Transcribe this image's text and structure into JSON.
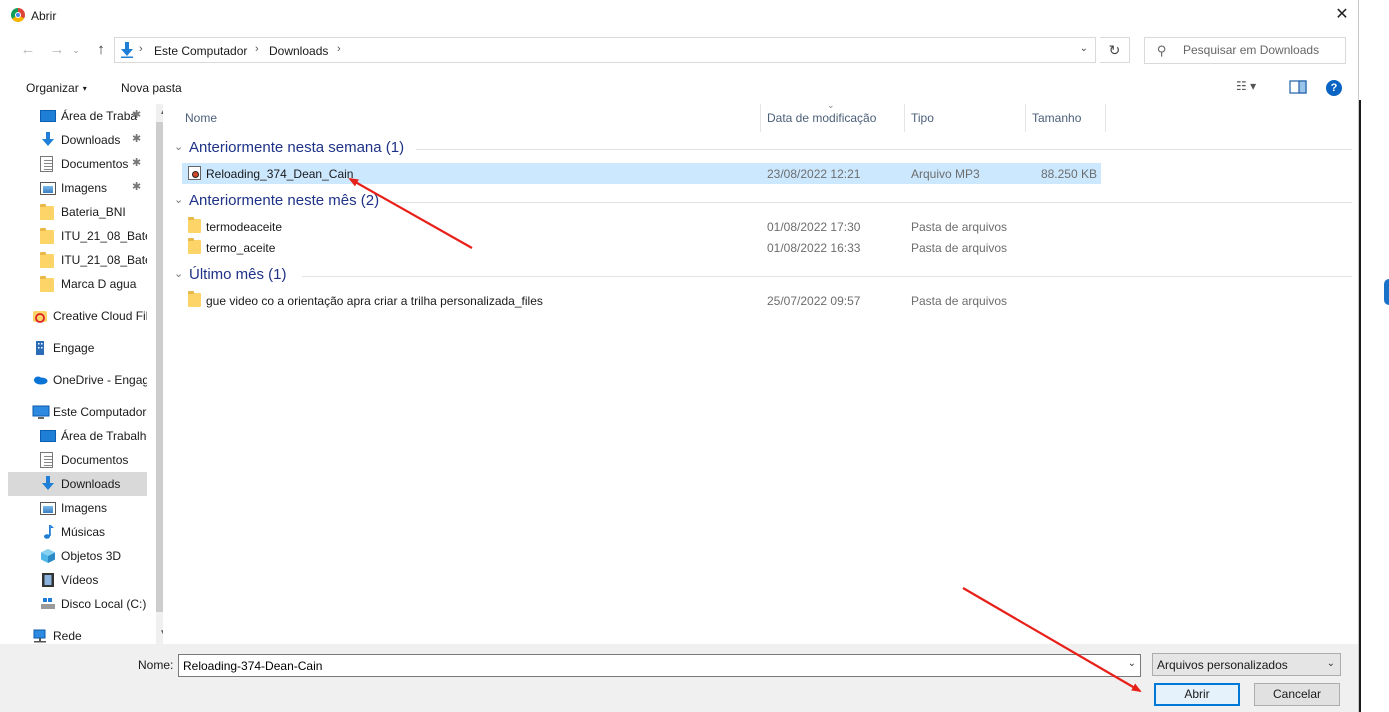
{
  "window": {
    "title": "Abrir",
    "close_glyph": "✕"
  },
  "nav": {
    "back_glyph": "←",
    "forward_glyph": "→",
    "recent_glyph": "⌄",
    "up_glyph": "↑",
    "breadcrumb": [
      "Este Computador",
      "Downloads"
    ],
    "breadcrumb_sep": "›",
    "refresh_glyph": "↻",
    "search_placeholder": "Pesquisar em Downloads"
  },
  "toolbar": {
    "organize_label": "Organizar",
    "organize_caret": "▾",
    "new_folder_label": "Nova pasta",
    "view_glyph": "☷ ▾",
    "help_glyph": "?"
  },
  "sidebar": {
    "pin_glyph": "✱",
    "items": [
      {
        "label": "Área de Traba",
        "icon": "desktop-icon",
        "pinned": true
      },
      {
        "label": "Downloads",
        "icon": "download-icon",
        "pinned": true
      },
      {
        "label": "Documentos",
        "icon": "document-icon",
        "pinned": true
      },
      {
        "label": "Imagens",
        "icon": "pictures-icon",
        "pinned": true
      },
      {
        "label": "Bateria_BNI",
        "icon": "folder-icon"
      },
      {
        "label": "ITU_21_08_Bateri",
        "icon": "folder-icon"
      },
      {
        "label": "ITU_21_08_Bateri",
        "icon": "folder-icon"
      },
      {
        "label": "Marca D agua",
        "icon": "folder-icon"
      },
      {
        "label": "Creative Cloud Fil",
        "icon": "creative-cloud-icon"
      },
      {
        "label": "Engage",
        "icon": "building-icon"
      },
      {
        "label": "OneDrive - Engag",
        "icon": "onedrive-icon"
      },
      {
        "label": "Este Computador",
        "icon": "computer-icon"
      },
      {
        "label": "Área de Trabalho",
        "icon": "desktop-icon"
      },
      {
        "label": "Documentos",
        "icon": "document-icon"
      },
      {
        "label": "Downloads",
        "icon": "download-icon",
        "selected": true
      },
      {
        "label": "Imagens",
        "icon": "pictures-icon"
      },
      {
        "label": "Músicas",
        "icon": "music-icon"
      },
      {
        "label": "Objetos 3D",
        "icon": "cube-icon"
      },
      {
        "label": "Vídeos",
        "icon": "video-icon"
      },
      {
        "label": "Disco Local (C:)",
        "icon": "drive-icon"
      },
      {
        "label": "Rede",
        "icon": "network-icon"
      }
    ]
  },
  "columns": {
    "name": "Nome",
    "date": "Data de modificação",
    "type": "Tipo",
    "size": "Tamanho"
  },
  "groups": [
    {
      "title": "Anteriormente nesta semana (1)",
      "files": [
        {
          "name": "Reloading_374_Dean_Cain",
          "date": "23/08/2022 12:21",
          "type": "Arquivo MP3",
          "size": "88.250 KB",
          "icon": "mp3-icon",
          "selected": true
        }
      ]
    },
    {
      "title": "Anteriormente neste mês (2)",
      "files": [
        {
          "name": "termodeaceite",
          "date": "01/08/2022 17:30",
          "type": "Pasta de arquivos",
          "size": "",
          "icon": "folder-icon"
        },
        {
          "name": "termo_aceite",
          "date": "01/08/2022 16:33",
          "type": "Pasta de arquivos",
          "size": "",
          "icon": "folder-icon"
        }
      ]
    },
    {
      "title": "Último mês (1)",
      "files": [
        {
          "name": "gue video co a orientação apra criar a trilha personalizada_files",
          "date": "25/07/2022 09:57",
          "type": "Pasta de arquivos",
          "size": "",
          "icon": "folder-icon"
        }
      ]
    }
  ],
  "footer": {
    "name_label": "Nome:",
    "name_value": "Reloading-374-Dean-Cain",
    "file_type": "Arquivos personalizados",
    "dropdown_glyph": "⌄",
    "open_label": "Abrir",
    "cancel_label": "Cancelar"
  },
  "colors": {
    "accent": "#0078d7",
    "selection": "#cce8ff",
    "group_header": "#1e3287",
    "annotation_arrow": "#e8201a"
  }
}
